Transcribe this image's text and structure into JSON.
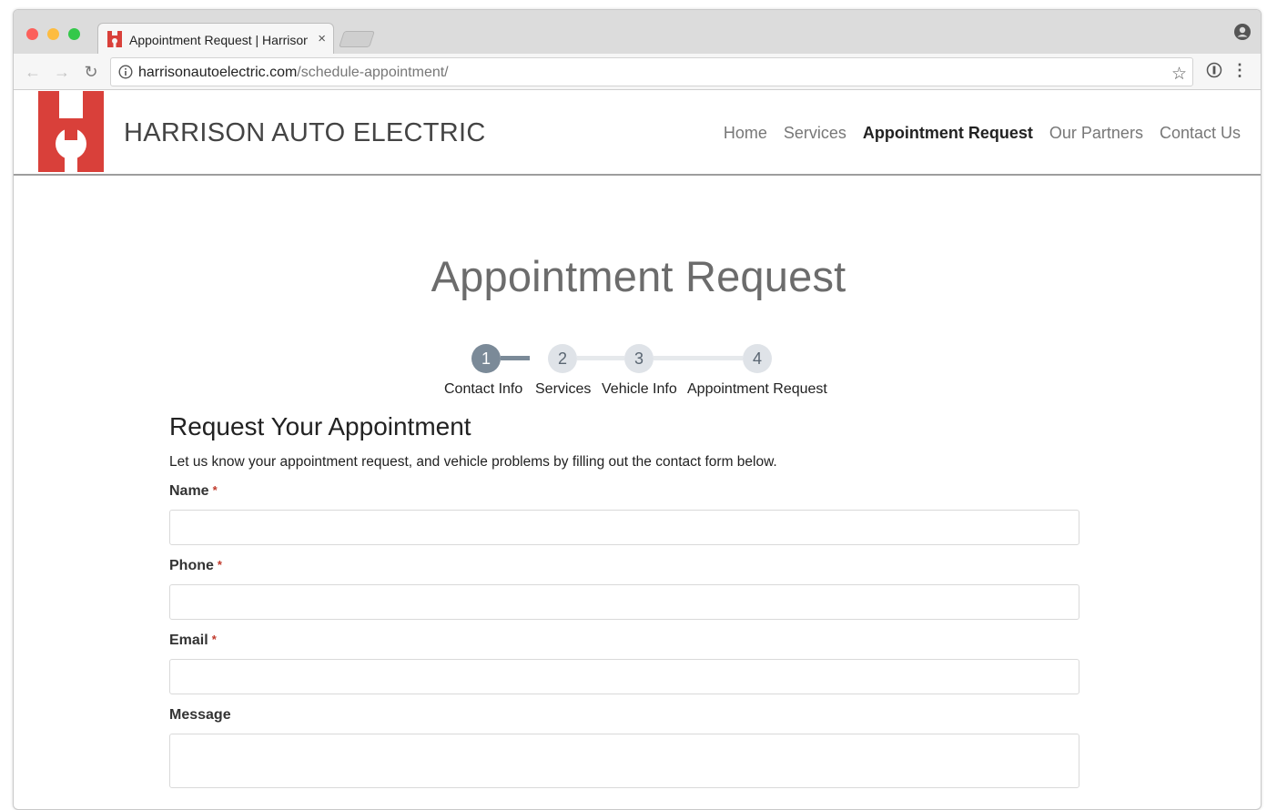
{
  "browser": {
    "tab_title": "Appointment Request | Harrison Auto Electric",
    "tab_close": "×",
    "url_host": "harrisonautoelectric.com",
    "url_path": "/schedule-appointment/"
  },
  "header": {
    "brand": "HARRISON AUTO ELECTRIC",
    "logo_color": "#d9403a",
    "nav": [
      {
        "label": "Home"
      },
      {
        "label": "Services"
      },
      {
        "label": "Appointment Request"
      },
      {
        "label": "Our Partners"
      },
      {
        "label": "Contact Us"
      }
    ]
  },
  "main": {
    "title": "Appointment Request",
    "stepper": {
      "steps": [
        {
          "number": "1",
          "label": "Contact Info"
        },
        {
          "number": "2",
          "label": "Services"
        },
        {
          "number": "3",
          "label": "Vehicle Info"
        },
        {
          "number": "4",
          "label": "Appointment Request"
        }
      ],
      "current_step": 1
    },
    "form": {
      "heading": "Request Your Appointment",
      "intro": "Let us know your appointment request, and vehicle problems by filling out the contact form below.",
      "required_marker": "*",
      "fields": [
        {
          "label": "Name",
          "value": ""
        },
        {
          "label": "Phone",
          "value": ""
        },
        {
          "label": "Email",
          "value": ""
        },
        {
          "label": "Message",
          "value": ""
        }
      ]
    }
  }
}
